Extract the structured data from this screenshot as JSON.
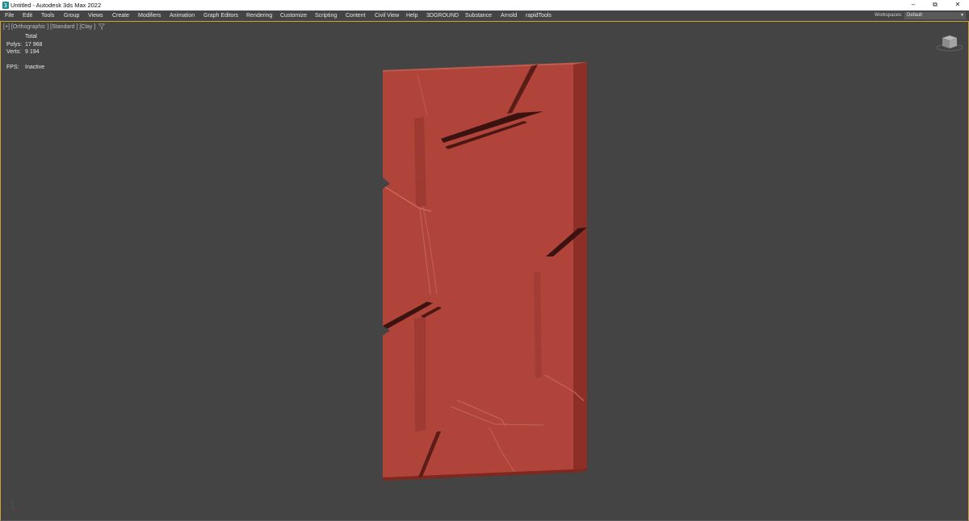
{
  "window": {
    "title": "Untitled - Autodesk 3ds Max 2022",
    "minimize": "–",
    "restore": "⧉",
    "close": "✕"
  },
  "menu": {
    "items": [
      "File",
      "Edit",
      "Tools",
      "Group",
      "Views",
      "Create",
      "Modifiers",
      "Animation",
      "Graph Editors",
      "Rendering",
      "Customize",
      "Scripting",
      "Content",
      "Civil View",
      "Help",
      "3DGROUND",
      "Substance",
      "Arnold",
      "rapidTools"
    ],
    "workspaces_label": "Workspaces:",
    "workspaces_value": "Default"
  },
  "viewport": {
    "label": "[+] [Orthographic ] [Standard ] [Clay ]",
    "stats": {
      "header": "Total",
      "polys_label": "Polys:",
      "polys_value": "17 968",
      "verts_label": "Verts:",
      "verts_value": "9 194",
      "fps_label": "FPS:",
      "fps_value": "Inactive"
    }
  },
  "colors": {
    "viewport_bg": "#444444",
    "accent_border": "#c9a23a",
    "clay_object": "#b0443a"
  },
  "icons": [
    "app-icon",
    "filter-icon",
    "viewcube-icon",
    "axis-tripod-icon"
  ]
}
